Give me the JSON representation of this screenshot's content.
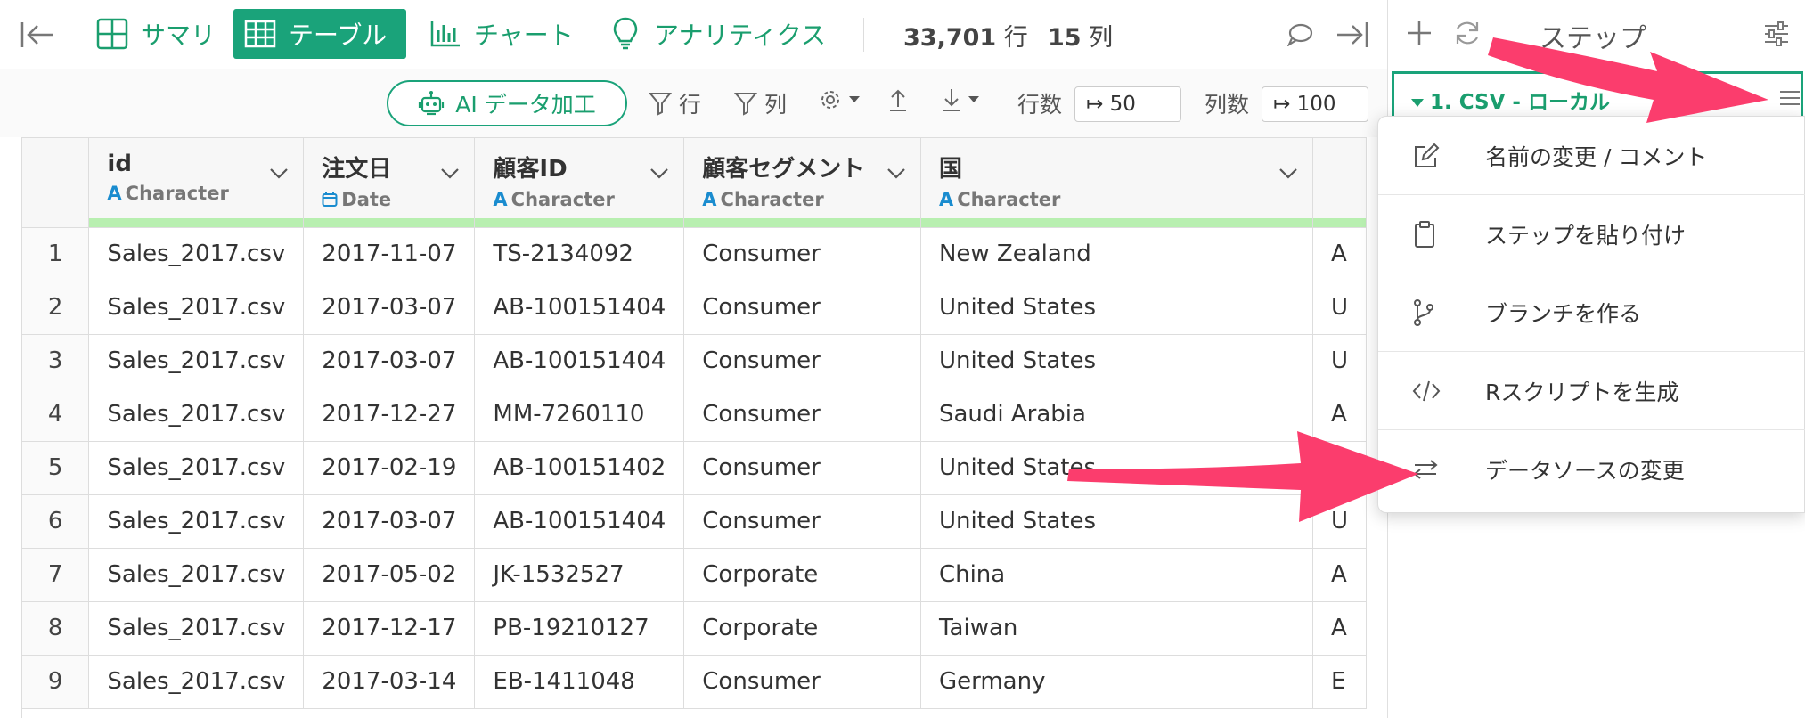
{
  "topbar": {
    "tabs": [
      {
        "label": "サマリ",
        "icon": "summary-grid-icon"
      },
      {
        "label": "テーブル",
        "icon": "table-icon"
      },
      {
        "label": "チャート",
        "icon": "bar-chart-icon"
      },
      {
        "label": "アナリティクス",
        "icon": "lightbulb-icon"
      }
    ],
    "row_count": "33,701",
    "row_unit": "行",
    "col_count": "15",
    "col_unit": "列"
  },
  "toolbar": {
    "ai_label": "AI データ加工",
    "row_filter_label": "行",
    "col_filter_label": "列",
    "rows_label": "行数",
    "rows_value": "↦ 50",
    "cols_label": "列数",
    "cols_value": "↦ 100"
  },
  "table": {
    "columns": [
      {
        "name": "id",
        "type": "Character",
        "type_icon": "A"
      },
      {
        "name": "注文日",
        "type": "Date",
        "type_icon": "calendar"
      },
      {
        "name": "顧客ID",
        "type": "Character",
        "type_icon": "A"
      },
      {
        "name": "顧客セグメント",
        "type": "Character",
        "type_icon": "A"
      },
      {
        "name": "国",
        "type": "Character",
        "type_icon": "A"
      }
    ],
    "rows": [
      {
        "n": "1",
        "id": "Sales_2017.csv",
        "date": "2017-11-07",
        "cust": "TS-2134092",
        "seg": "Consumer",
        "country": "New Zealand",
        "next": "A"
      },
      {
        "n": "2",
        "id": "Sales_2017.csv",
        "date": "2017-03-07",
        "cust": "AB-100151404",
        "seg": "Consumer",
        "country": "United States",
        "next": "U"
      },
      {
        "n": "3",
        "id": "Sales_2017.csv",
        "date": "2017-03-07",
        "cust": "AB-100151404",
        "seg": "Consumer",
        "country": "United States",
        "next": "U"
      },
      {
        "n": "4",
        "id": "Sales_2017.csv",
        "date": "2017-12-27",
        "cust": "MM-7260110",
        "seg": "Consumer",
        "country": "Saudi Arabia",
        "next": "A"
      },
      {
        "n": "5",
        "id": "Sales_2017.csv",
        "date": "2017-02-19",
        "cust": "AB-100151402",
        "seg": "Consumer",
        "country": "United States",
        "next": "U"
      },
      {
        "n": "6",
        "id": "Sales_2017.csv",
        "date": "2017-03-07",
        "cust": "AB-100151404",
        "seg": "Consumer",
        "country": "United States",
        "next": "U"
      },
      {
        "n": "7",
        "id": "Sales_2017.csv",
        "date": "2017-05-02",
        "cust": "JK-1532527",
        "seg": "Corporate",
        "country": "China",
        "next": "A"
      },
      {
        "n": "8",
        "id": "Sales_2017.csv",
        "date": "2017-12-17",
        "cust": "PB-19210127",
        "seg": "Corporate",
        "country": "Taiwan",
        "next": "A"
      },
      {
        "n": "9",
        "id": "Sales_2017.csv",
        "date": "2017-03-14",
        "cust": "EB-1411048",
        "seg": "Consumer",
        "country": "Germany",
        "next": "E"
      }
    ]
  },
  "right_panel": {
    "title": "ステップ",
    "step_title": "1. CSV - ローカル"
  },
  "context_menu": {
    "items": [
      {
        "label": "名前の変更 / コメント",
        "icon": "edit-icon"
      },
      {
        "label": "ステップを貼り付け",
        "icon": "clipboard-icon"
      },
      {
        "label": "ブランチを作る",
        "icon": "branch-icon"
      },
      {
        "label": "Rスクリプトを生成",
        "icon": "code-icon"
      },
      {
        "label": "データソースの変更",
        "icon": "swap-icon"
      }
    ]
  },
  "colors": {
    "accent": "#1aa37a",
    "type_header_bar": "#b8efb0",
    "annotation_arrow": "#fb3d6d"
  }
}
